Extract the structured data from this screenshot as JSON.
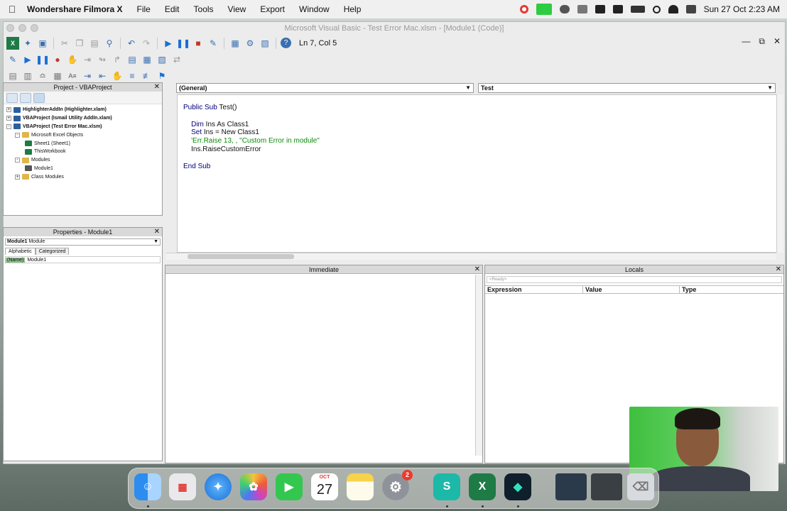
{
  "menubar": {
    "app_name": "Wondershare Filmora X",
    "items": [
      "File",
      "Edit",
      "Tools",
      "View",
      "Export",
      "Window",
      "Help"
    ],
    "clock": "Sun 27 Oct  2:23 AM"
  },
  "vbe": {
    "title": "Microsoft Visual Basic - Test Error Mac.xlsm - [Module1 (Code)]",
    "cursor_position": "Ln 7, Col 5"
  },
  "project": {
    "title": "Project - VBAProject",
    "nodes": [
      {
        "label": "HighlighterAddIn (Highlighter.xlam)",
        "level": 0,
        "expander": "+"
      },
      {
        "label": "VBAProject (Ismail Utility AddIn.xlam)",
        "level": 0,
        "expander": "+"
      },
      {
        "label": "VBAProject (Test Error Mac.xlsm)",
        "level": 0,
        "expander": "-"
      },
      {
        "label": "Microsoft Excel Objects",
        "level": 1,
        "expander": "-"
      },
      {
        "label": "Sheet1 (Sheet1)",
        "level": 2,
        "expander": ""
      },
      {
        "label": "ThisWorkbook",
        "level": 2,
        "expander": ""
      },
      {
        "label": "Modules",
        "level": 1,
        "expander": "-"
      },
      {
        "label": "Module1",
        "level": 2,
        "expander": ""
      },
      {
        "label": "Class Modules",
        "level": 1,
        "expander": "+"
      }
    ]
  },
  "properties": {
    "title": "Properties - Module1",
    "object_name": "Module1",
    "object_type": "Module",
    "tabs": [
      "Alphabetic",
      "Categorized"
    ],
    "row_key": "(Name)",
    "row_value": "Module1"
  },
  "code": {
    "object_combo": "(General)",
    "proc_combo": "Test",
    "lines": [
      {
        "kw": "Public Sub ",
        "rest": "Test()",
        "cm": ""
      },
      {
        "kw": "",
        "rest": "",
        "cm": ""
      },
      {
        "kw": "    Dim ",
        "rest": "Ins As Class1",
        "cm": ""
      },
      {
        "kw": "    Set ",
        "rest": "Ins = New Class1",
        "cm": ""
      },
      {
        "kw": "",
        "rest": "",
        "cm": "    'Err.Raise 13, , \"Custom Error in module\""
      },
      {
        "kw": "",
        "rest": "    Ins.RaiseCustomError",
        "cm": ""
      },
      {
        "kw": "",
        "rest": "",
        "cm": ""
      },
      {
        "kw": "End Sub",
        "rest": "",
        "cm": ""
      }
    ]
  },
  "immediate": {
    "title": "Immediate"
  },
  "locals": {
    "title": "Locals",
    "context": "<Ready>",
    "columns": [
      "Expression",
      "Value",
      "Type"
    ]
  },
  "dock": {
    "calendar_month": "OCT",
    "calendar_day": "27",
    "settings_badge": "2"
  },
  "colors": {
    "accent": "#3a6fb0",
    "comment": "#0a8a0a",
    "keyword": "#00007a"
  }
}
